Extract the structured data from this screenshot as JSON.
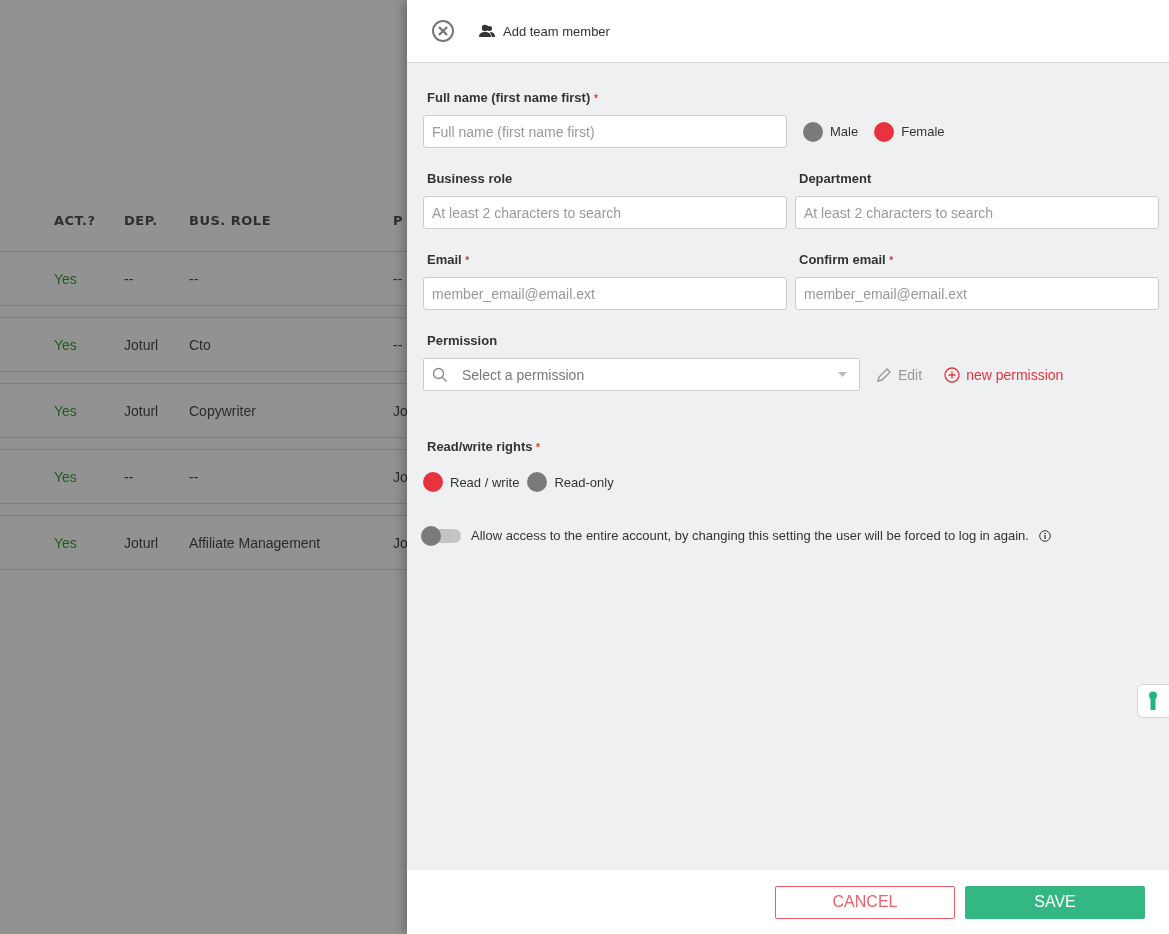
{
  "table": {
    "columns": [
      "ACT.?",
      "DEP.",
      "BUS. ROLE",
      "P"
    ],
    "rows": [
      [
        "Yes",
        "--",
        "--",
        "--"
      ],
      [
        "Yes",
        "Joturl",
        "Cto",
        "--"
      ],
      [
        "Yes",
        "Joturl",
        "Copywriter",
        "Jo"
      ],
      [
        "Yes",
        "--",
        "--",
        "Jo"
      ],
      [
        "Yes",
        "Joturl",
        "Affiliate Management",
        "Jo"
      ]
    ]
  },
  "panel": {
    "title": "Add team member",
    "full_name": {
      "label": "Full name (first name first)",
      "mark": "*",
      "placeholder": "Full name (first name first)"
    },
    "gender": [
      {
        "label": "Male",
        "selected": false
      },
      {
        "label": "Female",
        "selected": true
      }
    ],
    "pairs": [
      [
        {
          "label": "Business role",
          "placeholder": "At least 2 characters to search"
        },
        {
          "label": "Department",
          "placeholder": "At least 2 characters to search"
        }
      ],
      [
        {
          "label": "Email",
          "mark": "*",
          "placeholder": "member_email@email.ext"
        },
        {
          "label": "Confirm email",
          "mark": "*",
          "placeholder": "member_email@email.ext"
        }
      ]
    ],
    "permission": {
      "label": "Permission",
      "placeholder": "Select a permission",
      "edit": "Edit",
      "new": "new permission"
    },
    "rights": {
      "label": "Read/write rights",
      "mark": "*",
      "options": [
        {
          "label": "Read / write",
          "selected": true
        },
        {
          "label": "Read-only",
          "selected": false
        }
      ]
    },
    "full_access": {
      "label": "Allow access to the entire account, by changing this setting the user will be forced to log in again.",
      "on": false
    },
    "buttons": {
      "cancel": "CANCEL",
      "save": "SAVE"
    }
  }
}
